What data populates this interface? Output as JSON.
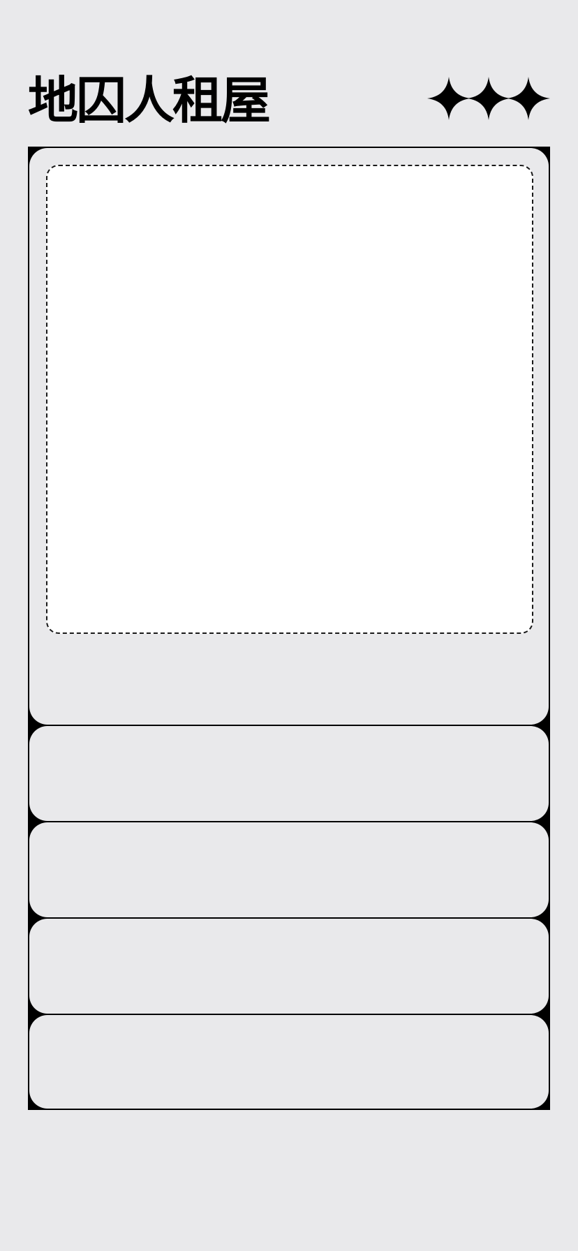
{
  "header": {
    "title": "地囚人租屋",
    "decoration_icons": [
      "sparkle-icon",
      "sparkle-icon",
      "sparkle-icon"
    ]
  },
  "colors": {
    "background": "#e9e9eb",
    "ink": "#000000",
    "card": "#e9e9eb",
    "photo_slot": "#ffffff"
  },
  "cards": [
    {
      "id": "main-card",
      "has_photo_slot": true
    },
    {
      "id": "card-2"
    },
    {
      "id": "card-3"
    },
    {
      "id": "card-4"
    },
    {
      "id": "card-5"
    }
  ]
}
